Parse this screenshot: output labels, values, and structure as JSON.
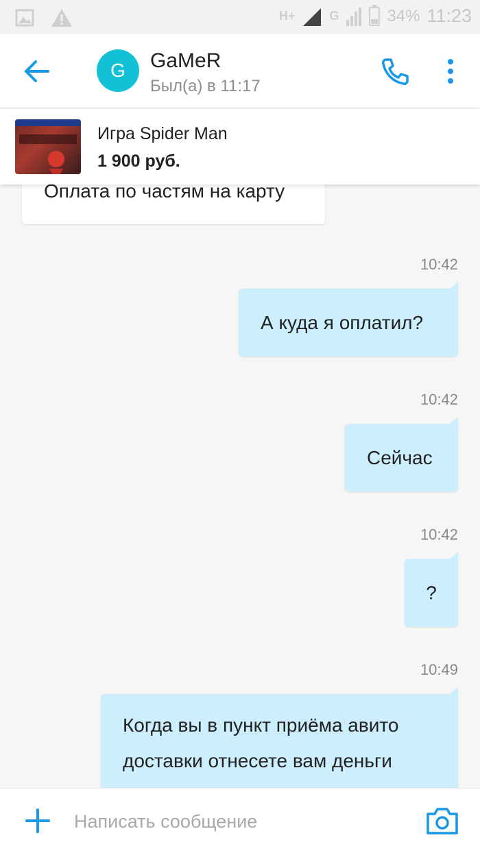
{
  "status_bar": {
    "network_1": "H+",
    "network_2": "G",
    "battery": "34%",
    "battery_level": 0.34,
    "time": "11:23",
    "icons": [
      "image-icon",
      "warning-icon",
      "signal-icon",
      "battery-icon"
    ]
  },
  "header": {
    "avatar_letter": "G",
    "name": "GaMeR",
    "status": "Был(а) в 11:17",
    "accent": "#1a98e8",
    "avatar_color": "#13c1d6"
  },
  "item": {
    "title": "Игра Spider Man",
    "price": "1 900 руб."
  },
  "messages": [
    {
      "direction": "in",
      "text": "Оплата по частям на карту"
    },
    {
      "direction": "out",
      "time": "10:42",
      "text": "А куда я оплатил?"
    },
    {
      "direction": "out",
      "time": "10:42",
      "text": "Сейчас"
    },
    {
      "direction": "out",
      "time": "10:42",
      "text": "?"
    },
    {
      "direction": "out",
      "time": "10:49",
      "text": "Когда вы в пункт приёма авито доставки отнесете вам деньги"
    }
  ],
  "composer": {
    "placeholder": "Написать сообщение"
  }
}
